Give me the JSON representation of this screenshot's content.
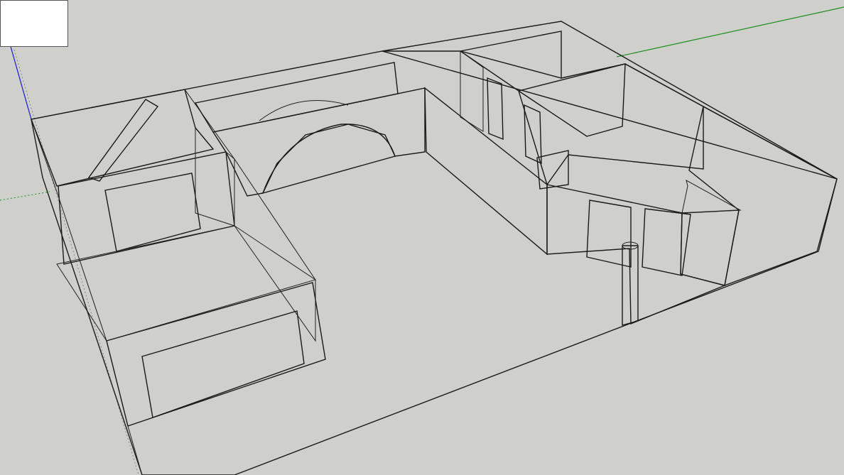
{
  "app": {
    "type": "3d-modeling-viewport",
    "background_color": "#cfcfcb"
  },
  "colors": {
    "face_light": "#ff5a56",
    "face_mid": "#e04b47",
    "face_floor": "#cd4542",
    "face_dark": "#b83d3a",
    "edge": "#1a1a1a",
    "axis_red": "#3aa63a",
    "axis_green": "#1d8f1d",
    "axis_blue": "#1a1acc"
  },
  "scene": {
    "model": "floor-plan-walls",
    "axes": [
      "green-axis",
      "blue-axis",
      "green-dotted-axis"
    ]
  },
  "inset_panel": {
    "present": true
  }
}
